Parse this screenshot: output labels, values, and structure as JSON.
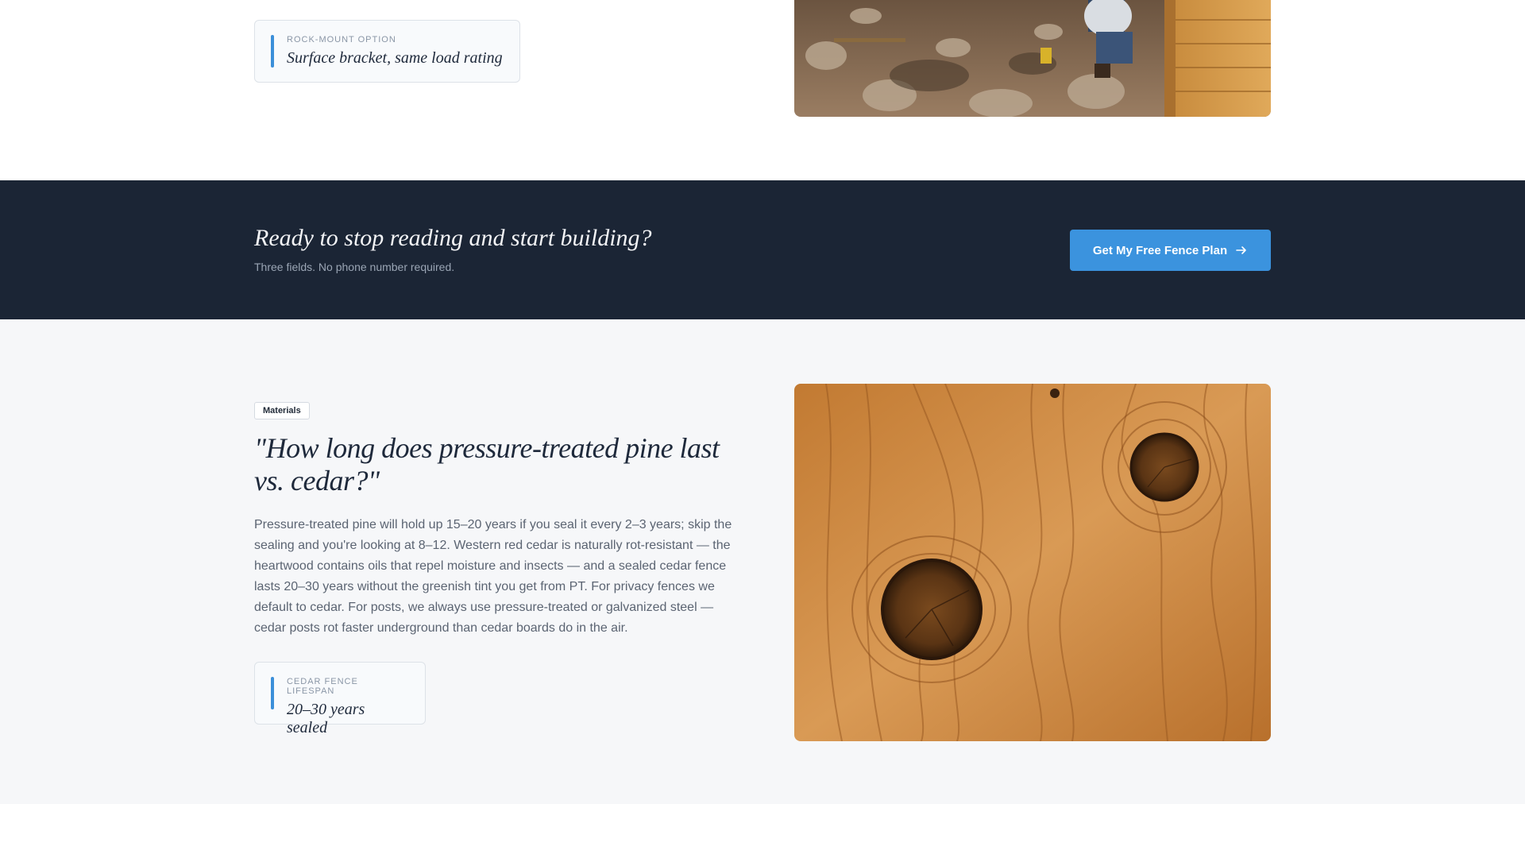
{
  "top": {
    "stat_label": "ROCK-MOUNT OPTION",
    "stat_value": "Surface bracket, same load rating",
    "photo_alt": "Worker installing fence post on rocky terrain"
  },
  "cta": {
    "title": "Ready to stop reading and start building?",
    "subtitle": "Three fields. No phone number required.",
    "button_label": "Get My Free Fence Plan",
    "button_icon": "arrow-right-icon"
  },
  "materials": {
    "tag": "Materials",
    "question": "\"How long does pressure-treated pine last vs. cedar?\"",
    "answer": "Pressure-treated pine will hold up 15–20 years if you seal it every 2–3 years; skip the sealing and you're looking at 8–12. Western red cedar is naturally rot-resistant — the heartwood contains oils that repel moisture and insects — and a sealed cedar fence lasts 20–30 years without the greenish tint you get from PT. For privacy fences we default to cedar. For posts, we always use pressure-treated or galvanized steel — cedar posts rot faster underground than cedar boards do in the air.",
    "stat_label": "CEDAR FENCE LIFESPAN",
    "stat_value": "20–30 years sealed",
    "photo_alt": "Close-up of cedar wood grain with knots"
  },
  "colors": {
    "accent": "#3b93de",
    "dark_band": "#1b2535",
    "section_bg": "#f6f7f9"
  }
}
